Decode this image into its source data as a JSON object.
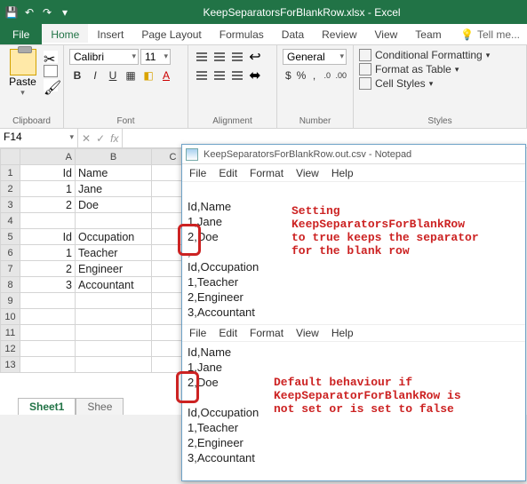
{
  "window": {
    "title": "KeepSeparatorsForBlankRow.xlsx - Excel",
    "namebox": "F14"
  },
  "ribbon": {
    "tabs": {
      "file": "File",
      "home": "Home",
      "insert": "Insert",
      "pagelayout": "Page Layout",
      "formulas": "Formulas",
      "data": "Data",
      "review": "Review",
      "view": "View",
      "team": "Team",
      "tellme": "Tell me..."
    },
    "clipboard": {
      "paste": "Paste",
      "label": "Clipboard"
    },
    "font": {
      "name": "Calibri",
      "size": "11",
      "label": "Font"
    },
    "alignment": {
      "label": "Alignment"
    },
    "number": {
      "format": "General",
      "label": "Number"
    },
    "styles": {
      "cond": "Conditional Formatting",
      "table": "Format as Table",
      "cell": "Cell Styles",
      "label": "Styles"
    }
  },
  "sheet": {
    "columns": [
      "A",
      "B",
      "C"
    ],
    "rows": [
      "1",
      "2",
      "3",
      "4",
      "5",
      "6",
      "7",
      "8",
      "9",
      "10",
      "11",
      "12",
      "13"
    ],
    "cells": {
      "A1": "Id",
      "B1": "Name",
      "A2": "1",
      "B2": "Jane",
      "A3": "2",
      "B3": "Doe",
      "A5": "Id",
      "B5": "Occupation",
      "A6": "1",
      "B6": "Teacher",
      "A7": "2",
      "B7": "Engineer",
      "A8": "3",
      "B8": "Accountant"
    },
    "tabs": {
      "active": "Sheet1",
      "next": "Shee"
    }
  },
  "notepad": {
    "title": "KeepSeparatorsForBlankRow.out.csv - Notepad",
    "menu": {
      "file": "File",
      "edit": "Edit",
      "format": "Format",
      "view": "View",
      "help": "Help"
    },
    "top_lines": [
      "Id,Name",
      "1,Jane",
      "2,Doe",
      ",",
      "Id,Occupation",
      "1,Teacher",
      "2,Engineer",
      "3,Accountant"
    ],
    "bottom_lines": [
      "Id,Name",
      "1,Jane",
      "2,Doe",
      "",
      "Id,Occupation",
      "1,Teacher",
      "2,Engineer",
      "3,Accountant"
    ]
  },
  "annotations": {
    "top": "Setting\nKeepSeparatorsForBlankRow\nto true keeps the separator\nfor the blank row",
    "bottom": "Default behaviour if\nKeepSeparatorForBlankRow is\nnot set or is set to false"
  }
}
